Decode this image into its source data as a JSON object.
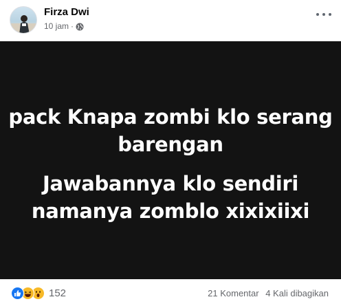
{
  "post": {
    "author": "Firza Dwi",
    "timestamp": "10 jam",
    "separator": "·",
    "privacy_icon": "globe-icon",
    "image_text": {
      "line1": "pack Knapa zombi klo serang",
      "line2": "barengan",
      "line3": "Jawabannya klo sendiri",
      "line4": "namanya zomblo xixixiixi"
    },
    "colors": {
      "image_bg": "#131313",
      "text": "#ffffff",
      "like": "#1877f2",
      "emoji": "#f7b928"
    }
  },
  "footer": {
    "reaction_icons": [
      "like-icon",
      "haha-icon",
      "wow-icon"
    ],
    "reaction_count": "152",
    "comments": "21 Komentar",
    "shares": "4 Kali dibagikan"
  }
}
